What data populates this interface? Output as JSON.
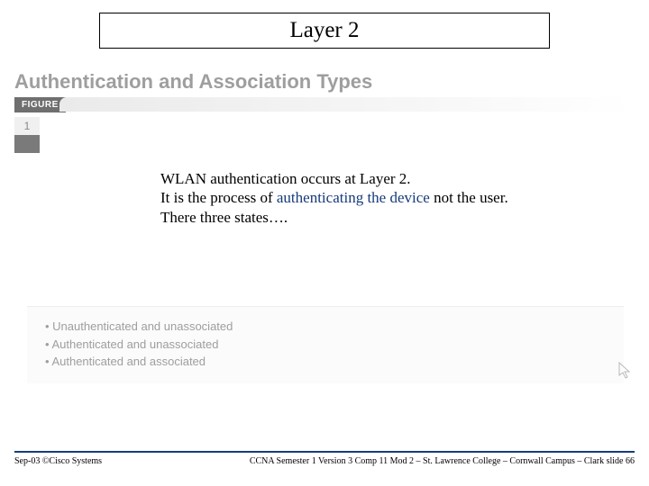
{
  "title": "Layer 2",
  "section_heading": "Authentication and Association Types",
  "figure_label": "FIGURE",
  "figure_number": "1",
  "body": {
    "line1": "WLAN authentication occurs at Layer 2.",
    "line2a": "It is the process of ",
    "line2b": "authenticating the device",
    "line2c": " not the user.",
    "line3": "There three states…."
  },
  "states": [
    "Unauthenticated and unassociated",
    "Authenticated and unassociated",
    "Authenticated and associated"
  ],
  "footer": {
    "left": "Sep-03 ©Cisco Systems",
    "right": "CCNA Semester 1 Version 3 Comp 11 Mod 2 – St. Lawrence College – Cornwall Campus – Clark slide  66"
  }
}
